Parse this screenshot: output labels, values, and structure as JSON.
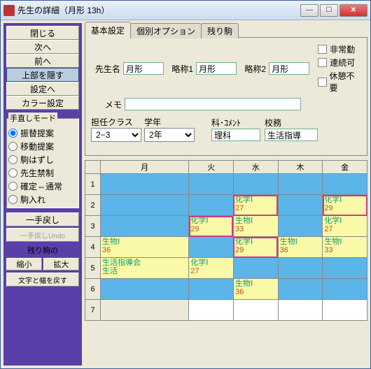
{
  "window": {
    "title": "先生の詳細（月形 13h）"
  },
  "sidebar": {
    "buttons": [
      "閉じる",
      "次へ",
      "前へ",
      "上部を隠す",
      "設定へ",
      "カラー設定"
    ],
    "active_index": 3,
    "radios_title": "手直しモード",
    "radios": [
      "振替提案",
      "移動提案",
      "駒はずし",
      "先生禁制",
      "確定⇔通常",
      "駒入れ"
    ],
    "radio_selected": 0,
    "undo1": "一手戻し",
    "undo2": "一手戻しUndo",
    "remain_label": "残り駒の",
    "zoom_out": "縮小",
    "zoom_in": "拡大",
    "reset": "文字と幅を戻す"
  },
  "tabs": {
    "items": [
      "基本設定",
      "個別オプション",
      "残り駒"
    ],
    "active": 0
  },
  "form": {
    "name_label": "先生名",
    "name": "月形",
    "abbr1_label": "略称1",
    "abbr1": "月形",
    "abbr2_label": "略称2",
    "abbr2": "月形",
    "memo_label": "メモ",
    "memo": "",
    "class_label": "担任クラス",
    "class": "2−3",
    "grade_label": "学年",
    "grade": "2年",
    "subj_label": "科･ｺﾒﾝﾄ",
    "subj": "理科",
    "duty_label": "校務",
    "duty": "生活指導",
    "chk1": "非常勤",
    "chk2": "連続可",
    "chk3": "休憩不要"
  },
  "grid": {
    "days": [
      "月",
      "火",
      "水",
      "木",
      "金"
    ],
    "rows": [
      [
        {
          "c": "blue"
        },
        {
          "c": "blue"
        },
        {
          "c": "blue"
        },
        {
          "c": "blue"
        },
        {
          "c": "blue"
        }
      ],
      [
        {
          "c": "blue"
        },
        {
          "c": "blue"
        },
        {
          "c": "yellow",
          "t": "化学Ⅰ",
          "n": "27",
          "hl": 1
        },
        {
          "c": "blue"
        },
        {
          "c": "yellow",
          "t": "化学Ⅰ",
          "n": "29",
          "hl": 1
        }
      ],
      [
        {
          "c": "blue"
        },
        {
          "c": "yellow",
          "t": "化学Ⅰ",
          "n": "29",
          "hl": 1
        },
        {
          "c": "yellow",
          "t": "生物Ⅰ",
          "n": "33"
        },
        {
          "c": "blue"
        },
        {
          "c": "yellow",
          "t": "化学Ⅰ",
          "n": "27"
        }
      ],
      [
        {
          "c": "yellow",
          "t": "生物Ⅰ",
          "n": "36"
        },
        {
          "c": "blue"
        },
        {
          "c": "yellow",
          "t": "化学Ⅰ",
          "n": "29",
          "hl": 1
        },
        {
          "c": "yellow",
          "t": "生物Ⅰ",
          "n": "36"
        },
        {
          "c": "yellow",
          "t": "生物Ⅰ",
          "n": "33"
        }
      ],
      [
        {
          "c": "yellow",
          "t": "生活指導会",
          "n": "生活",
          "nc": "g"
        },
        {
          "c": "yellow",
          "t": "化学Ⅰ",
          "n": "27"
        },
        {
          "c": "blue"
        },
        {
          "c": "blue"
        },
        {
          "c": "blue"
        }
      ],
      [
        {
          "c": "blue"
        },
        {
          "c": "blue"
        },
        {
          "c": "yellow",
          "t": "生物Ⅰ",
          "n": "36"
        },
        {
          "c": "blue"
        },
        {
          "c": "blue"
        }
      ],
      [
        {
          "c": "gray"
        },
        {
          "c": "white"
        },
        {
          "c": "white"
        },
        {
          "c": "white"
        },
        {
          "c": "white"
        }
      ]
    ]
  }
}
